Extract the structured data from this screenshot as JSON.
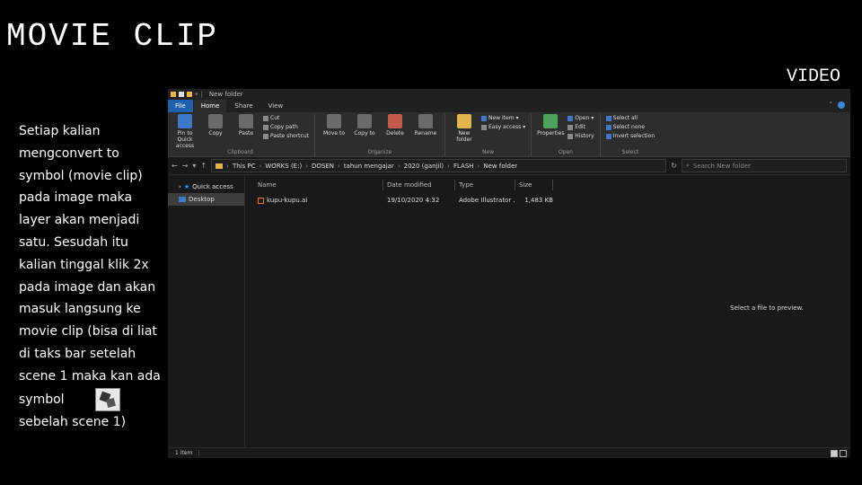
{
  "slide": {
    "title": "MOVIE CLIP",
    "subtitle": "VIDEO",
    "body_lines": [
      "Setiap kalian",
      "mengconvert to",
      "symbol (movie clip)",
      "pada image maka",
      "layer akan menjadi",
      "satu. Sesudah itu",
      "kalian tinggal klik 2x",
      "pada image dan akan",
      "masuk langsung ke",
      "movie clip (bisa di liat",
      "di taks bar setelah",
      "scene 1 maka kan ada",
      "symbol",
      "sebelah scene 1)"
    ],
    "symbol_icon": "puzzle-symbol-icon"
  },
  "explorer": {
    "window_title": "New folder",
    "tabs": [
      "File",
      "Home",
      "Share",
      "View"
    ],
    "ribbon": {
      "clipboard": {
        "pin_label": "Pin to Quick access",
        "copy_label": "Copy",
        "paste_label": "Paste",
        "cut_label": "Cut",
        "copy_path_label": "Copy path",
        "paste_shortcut_label": "Paste shortcut",
        "group_label": "Clipboard"
      },
      "organize": {
        "move_label": "Move to",
        "copy_to_label": "Copy to",
        "delete_label": "Delete",
        "rename_label": "Rename",
        "group_label": "Organize"
      },
      "new": {
        "new_folder_label": "New folder",
        "new_item_label": "New item",
        "easy_access_label": "Easy access",
        "group_label": "New"
      },
      "open": {
        "properties_label": "Properties",
        "open_label": "Open",
        "edit_label": "Edit",
        "history_label": "History",
        "group_label": "Open"
      },
      "select": {
        "select_all_label": "Select all",
        "select_none_label": "Select none",
        "invert_label": "Invert selection",
        "group_label": "Select"
      }
    },
    "address": {
      "crumbs": [
        "This PC",
        "WORKS (E:)",
        "DOSEN",
        "tahun mengajar",
        "2020 (ganjil)",
        "FLASH",
        "New folder"
      ],
      "search_placeholder": "Search New folder"
    },
    "nav_pane": {
      "quick_access_label": "Quick access",
      "desktop_label": "Desktop"
    },
    "columns": [
      "Name",
      "Date modified",
      "Type",
      "Size"
    ],
    "files": [
      {
        "name": "kupu-kupu.ai",
        "date_modified": "19/10/2020 4:32",
        "type": "Adobe Illustrator ...",
        "size": "1,483 KB"
      }
    ],
    "preview_text": "Select a file to preview.",
    "status": {
      "item_count": "1 item"
    }
  },
  "colors": {
    "background": "#000000",
    "explorer_bg": "#191919",
    "ribbon_bg": "#2d2d2d",
    "file_tab": "#1e5fae",
    "folder_yellow": "#e1b54c"
  }
}
